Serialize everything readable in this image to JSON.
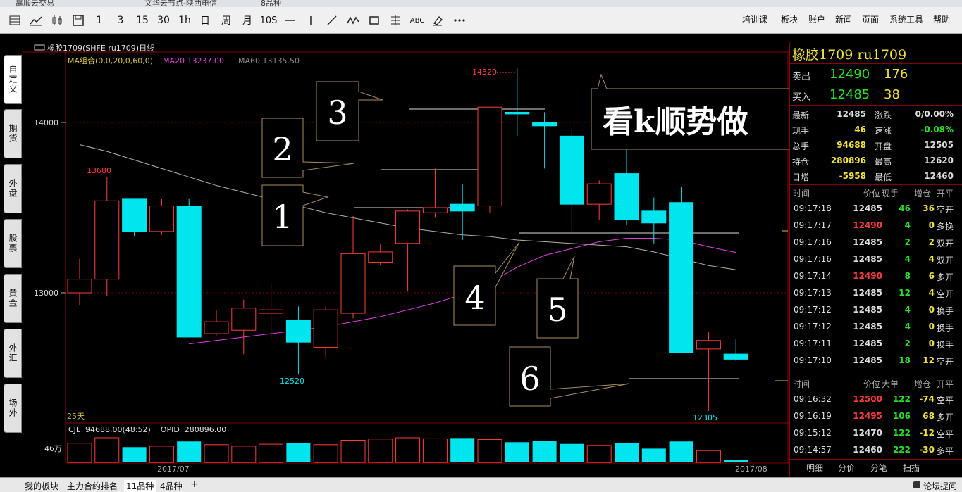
{
  "window": {
    "title_left": "赢顺云交易",
    "title_mid": "文华云节点-陕西电信",
    "title_right": "8品种"
  },
  "toolbar": {
    "buttons": [
      "1",
      "3",
      "15",
      "30",
      "1h",
      "日",
      "周",
      "月",
      "10S",
      "ABC"
    ],
    "menu": [
      "培训课",
      "板块",
      "账户",
      "新闻",
      "页面",
      "系统工具",
      "帮助"
    ]
  },
  "left_tabs": [
    "自定义",
    "期货",
    "外盘",
    "股票",
    "黄金",
    "外汇",
    "场外"
  ],
  "chart": {
    "header": "橡胶1709(SHFE ru1709)日线",
    "ma_label": "MA组合(0,0,20,0,60,0)",
    "ma20_label": "MA20 13237.00",
    "ma60_label": "MA60 13135.50",
    "y_ticks": [
      "14000",
      "13000"
    ],
    "high_label": "14320",
    "mark_13680": "13680",
    "mark_12520": "12520",
    "mark_12305": "12305",
    "days_label": "25天",
    "x_labels": [
      "2017/07",
      "2017/08"
    ],
    "vol_header": "CJL  94688.00(48:52)    OPID  280896.00",
    "vol_axis": "46万",
    "callouts": [
      "1",
      "2",
      "3",
      "4",
      "5",
      "6"
    ],
    "big_callout": "看k顺势做",
    "colors": {
      "up": "#ff3c3c",
      "down": "#00e5ee",
      "ma20": "#e040e0",
      "ma60": "#b0b0a0"
    },
    "chart_data": {
      "type": "candlestick",
      "fields": [
        "open",
        "high",
        "low",
        "close"
      ],
      "candles": [
        [
          13000,
          13200,
          12930,
          13080
        ],
        [
          13080,
          13680,
          12980,
          13540
        ],
        [
          13550,
          13550,
          13330,
          13360
        ],
        [
          13360,
          13550,
          13340,
          13510
        ],
        [
          13510,
          13550,
          12760,
          12740
        ],
        [
          12760,
          12900,
          12750,
          12830
        ],
        [
          12780,
          12960,
          12640,
          12910
        ],
        [
          12880,
          13050,
          12730,
          12900
        ],
        [
          12840,
          12920,
          12520,
          12710
        ],
        [
          12680,
          12920,
          12620,
          12900
        ],
        [
          12880,
          13450,
          12850,
          13230
        ],
        [
          13180,
          13290,
          13160,
          13240
        ],
        [
          13290,
          13490,
          13010,
          13480
        ],
        [
          13470,
          13730,
          13440,
          13500
        ],
        [
          13520,
          13640,
          13310,
          13480
        ],
        [
          13510,
          14080,
          13470,
          14090
        ],
        [
          14060,
          14320,
          13920,
          14050
        ],
        [
          14000,
          14060,
          13730,
          13980
        ],
        [
          13920,
          13960,
          13360,
          13520
        ],
        [
          13520,
          13660,
          13430,
          13640
        ],
        [
          13700,
          14000,
          13400,
          13430
        ],
        [
          13480,
          13560,
          13290,
          13410
        ],
        [
          13530,
          13620,
          12800,
          12650
        ],
        [
          12670,
          12770,
          12305,
          12720
        ],
        [
          12640,
          12730,
          12600,
          12610
        ]
      ],
      "ma20": [
        null,
        null,
        null,
        null,
        12700,
        12720,
        12740,
        12760,
        12780,
        12800,
        12830,
        12860,
        12900,
        12940,
        12990,
        13060,
        13150,
        13220,
        13260,
        13300,
        13320,
        13320,
        13310,
        13270,
        13237
      ],
      "ma60": [
        13870,
        13830,
        13780,
        13730,
        13680,
        13630,
        13590,
        13550,
        13510,
        13470,
        13440,
        13410,
        13380,
        13360,
        13340,
        13330,
        13310,
        13300,
        13290,
        13280,
        13270,
        13240,
        13200,
        13160,
        13135.5
      ],
      "volume_relative": [
        0.78,
        1.0,
        0.62,
        0.66,
        0.85,
        0.72,
        0.66,
        0.74,
        0.8,
        0.72,
        0.9,
        0.95,
        1.0,
        0.96,
        0.99,
        0.93,
        0.82,
        0.88,
        0.75,
        0.69,
        0.8,
        0.56,
        0.85,
        0.48,
        0.1
      ]
    }
  },
  "quote": {
    "title": "橡胶1709  ru1709",
    "sell_label": "卖出",
    "sell_price": "12490",
    "sell_qty": "176",
    "buy_label": "买入",
    "buy_price": "12485",
    "buy_qty": "38",
    "stats": [
      [
        "最新",
        "12485",
        "涨跌",
        "0/0.00%"
      ],
      [
        "现手",
        "46",
        "速涨",
        "-0.08%"
      ],
      [
        "总手",
        "94688",
        "开盘",
        "12505"
      ],
      [
        "持仓",
        "280896",
        "最高",
        "12620"
      ],
      [
        "日增",
        "-5958",
        "最低",
        "12460"
      ]
    ],
    "ticks_header": [
      "时间",
      "价位",
      "现手",
      "增仓",
      "开平"
    ],
    "ticks": [
      [
        "09:17:18",
        "12485",
        "46",
        "36",
        "空开"
      ],
      [
        "09:17:17",
        "12490",
        "4",
        "0",
        "多换"
      ],
      [
        "09:17:16",
        "12485",
        "2",
        "2",
        "双开"
      ],
      [
        "09:17:16",
        "12485",
        "4",
        "4",
        "双开"
      ],
      [
        "09:17:14",
        "12490",
        "8",
        "6",
        "多开"
      ],
      [
        "09:17:13",
        "12485",
        "12",
        "4",
        "空开"
      ],
      [
        "09:17:12",
        "12485",
        "4",
        "0",
        "换手"
      ],
      [
        "09:17:12",
        "12485",
        "4",
        "0",
        "换手"
      ],
      [
        "09:17:11",
        "12485",
        "2",
        "0",
        "换手"
      ],
      [
        "09:17:10",
        "12485",
        "18",
        "12",
        "空开"
      ]
    ],
    "big_header": [
      "时间",
      "价位",
      "大单",
      "增仓",
      "开平"
    ],
    "big_orders": [
      [
        "09:16:32",
        "12500",
        "122",
        "-74",
        "空平"
      ],
      [
        "09:16:19",
        "12495",
        "106",
        "68",
        "多开"
      ],
      [
        "09:15:12",
        "12470",
        "122",
        "-12",
        "空平"
      ],
      [
        "09:14:57",
        "12460",
        "222",
        "-30",
        "多平"
      ]
    ],
    "tabs": [
      "明细",
      "分价",
      "分笔",
      "扫描"
    ]
  },
  "bottom": {
    "tabs": [
      "我的板块",
      "主力合约排名",
      "11品种",
      "4品种",
      "+"
    ],
    "forum": "论坛提问"
  }
}
